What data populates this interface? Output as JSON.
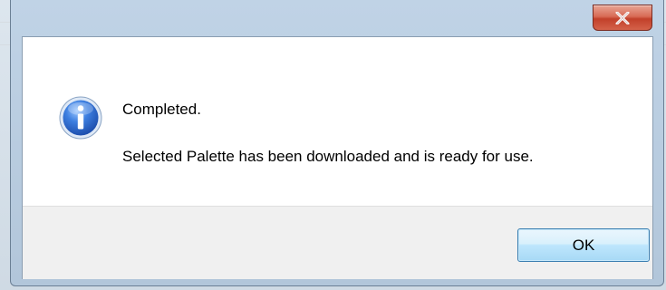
{
  "dialog": {
    "close_glyph": "x",
    "icon": "info-icon",
    "title_text": "Completed.",
    "message_text": "Selected Palette has been downloaded and is ready for use.",
    "ok_label": "OK"
  },
  "colors": {
    "close_button": "#c2402a",
    "ok_button_border": "#3c7fb1",
    "button_area": "#f0f0f0",
    "info_icon_blue": "#2f6fd1"
  }
}
